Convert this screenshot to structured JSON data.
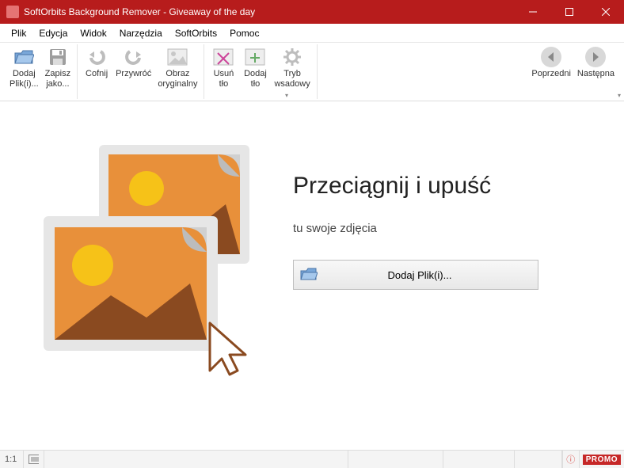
{
  "window": {
    "title": "SoftOrbits Background Remover - Giveaway of the day"
  },
  "menu": {
    "file": "Plik",
    "edit": "Edycja",
    "view": "Widok",
    "tools": "Narzędzia",
    "softorbits": "SoftOrbits",
    "help": "Pomoc"
  },
  "toolbar": {
    "add_files": "Dodaj\nPlik(i)...",
    "save_as": "Zapisz\njako...",
    "undo": "Cofnij",
    "redo": "Przywróć",
    "original": "Obraz\noryginalny",
    "remove_bg": "Usuń\ntło",
    "add_bg": "Dodaj\ntło",
    "batch": "Tryb\nwsadowy",
    "prev": "Poprzedni",
    "next": "Następna"
  },
  "drop": {
    "heading": "Przeciągnij i upuść",
    "sub": "tu swoje zdjęcia",
    "button": "Dodaj Plik(i)..."
  },
  "status": {
    "zoom": "1:1",
    "promo": "PROMO"
  },
  "colors": {
    "accent": "#b71c1c",
    "orange": "#e8903a",
    "yellow": "#f6c218"
  }
}
